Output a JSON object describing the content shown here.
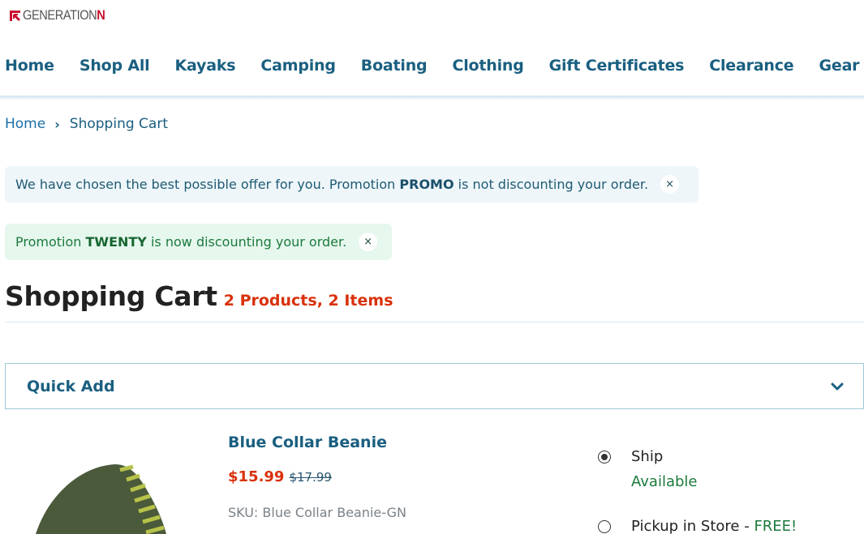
{
  "brand": {
    "logo_text": "GENERATION",
    "logo_accent": "N",
    "accent_color": "#c8102e"
  },
  "nav": {
    "items": [
      "Home",
      "Shop All",
      "Kayaks",
      "Camping",
      "Boating",
      "Clothing",
      "Gift Certificates",
      "Clearance",
      "Gear"
    ]
  },
  "breadcrumb": {
    "home": "Home",
    "current": "Shopping Cart"
  },
  "alerts": {
    "info": {
      "prefix": "We have chosen the best possible offer for you. Promotion ",
      "code": "PROMO",
      "suffix": " is not discounting your order.",
      "close": "×"
    },
    "success": {
      "prefix": "Promotion ",
      "code": "TWENTY",
      "suffix": " is now discounting your order.",
      "close": "×"
    }
  },
  "cart": {
    "title": "Shopping Cart",
    "count_text": "2 Products, 2 Items"
  },
  "quick_add": {
    "label": "Quick Add",
    "icon": "chevron-down-icon"
  },
  "product": {
    "name": "Blue Collar Beanie",
    "sale_price": "$15.99",
    "original_price": "$17.99",
    "sku": "SKU: Blue Collar Beanie-GN",
    "fulfillment": {
      "ship": {
        "label": "Ship",
        "status": "Available",
        "selected": true
      },
      "pickup": {
        "label": "Pickup in Store - ",
        "free": "FREE!",
        "selected": false
      }
    }
  },
  "colors": {
    "nav": "#1a5f80",
    "price_red": "#d9310b",
    "success_green": "#1c7a3c"
  }
}
